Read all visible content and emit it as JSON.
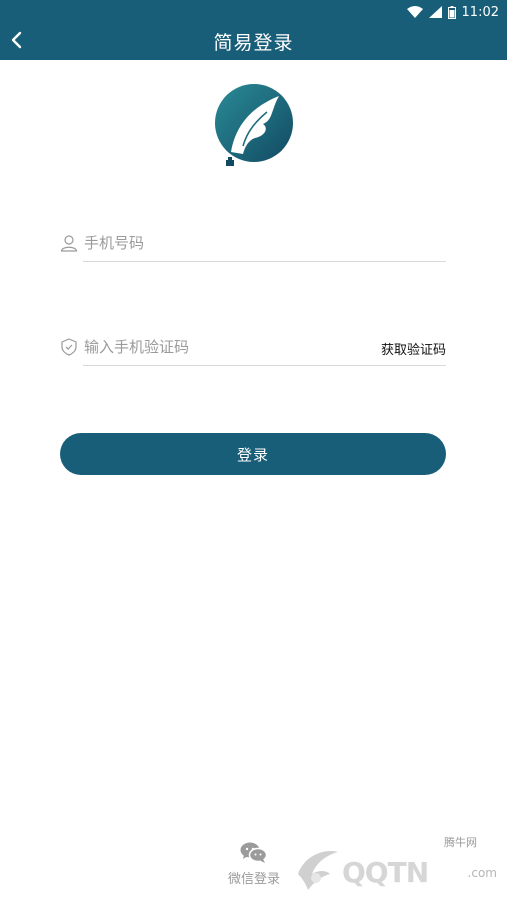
{
  "status_bar": {
    "time": "11:02"
  },
  "header": {
    "title": "简易登录"
  },
  "form": {
    "phone_placeholder": "手机号码",
    "code_placeholder": "输入手机验证码",
    "get_code_label": "获取验证码",
    "login_label": "登录"
  },
  "footer": {
    "wechat_label": "微信登录"
  },
  "watermark": {
    "site_cn": "腾牛网",
    "brand": "QQTN",
    "domain": ".com"
  },
  "colors": {
    "primary": "#185e78",
    "placeholder": "#9a9a9a",
    "divider": "#d9d9d9"
  }
}
